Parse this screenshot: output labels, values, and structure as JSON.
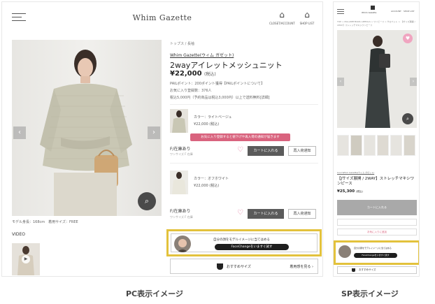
{
  "pc": {
    "header": {
      "logo": "Whim Gazette",
      "icons": [
        {
          "name": "closet-icon",
          "label": "CLOSET/ACCOUNT"
        },
        {
          "name": "shop-list-icon",
          "label": "SHOP LIST"
        }
      ]
    },
    "image": {
      "caption": "モデル身長：168cm　着用サイズ：FREE",
      "zoom_label": "拡大画像"
    },
    "video_label": "VIDEO",
    "product": {
      "category": "トップス / 長袖",
      "brand": "Whim Gazette(ウィム ガゼット)",
      "title": "2wayアイレットメッシュニット",
      "price": "¥22,000",
      "tax": "(税込)",
      "points": "PAILポイント：200ポイント獲得【PAILポイントについて】",
      "favorites": "お気に入り登録数：376人",
      "shipping": "税込5,000円（予約商品は税込3,000円）以上で送料無料[詳細]"
    },
    "variants": [
      {
        "color": "カラー：ライトベージュ",
        "price": "¥22,000",
        "tax": "(税込)",
        "stock": "F/在庫あり",
        "stock_sub": "ワンサイズ F 在庫",
        "cart": "カートに入れる",
        "notify": "再入荷通知"
      },
      {
        "color": "カラー：オフホワイト",
        "price": "¥22,000",
        "tax": "(税込)",
        "stock": "F/在庫あり",
        "stock_sub": "ワンサイズ F 在庫",
        "cart": "カートに入れる",
        "notify": "再入荷通知"
      }
    ],
    "tooltip": "お気に入り登録すると値下げや再入荷の通知が届きます",
    "facechange": {
      "text": "自分の顔をモデルイメージに当てはめる",
      "button": "FaceChangeをいますぐ試す"
    },
    "size": {
      "label": "おすすめサイズ",
      "link": "着用感を見る ›"
    }
  },
  "sp": {
    "logo": "Whim Gazette",
    "header_right": [
      "ACCOUNT",
      "SHOP LIST"
    ],
    "breadcrumb": "TOP > MALAMEHEANS APPEALS > ワンピース > サロペット > 【Jサイズ展開 / 2WAY】ストレッチマキシワンピース",
    "brand": "Cool Whim Gazette(ウィム ガゼット)",
    "title": "【Jサイズ展開 / 2WAY】ストレッチマキシワンピース",
    "price": "¥25,300",
    "tax": "(税込)",
    "cart": "カートに入れる",
    "fav_btn": "お気に入りに追加",
    "facechange_text": "自分の顔をモデルイメージに当てはめる",
    "facechange_btn": "FaceChangeをいますぐ試す",
    "size_label": "おすすめサイズ"
  },
  "captions": {
    "pc": "PC表示イメージ",
    "sp": "SP表示イメージ"
  }
}
